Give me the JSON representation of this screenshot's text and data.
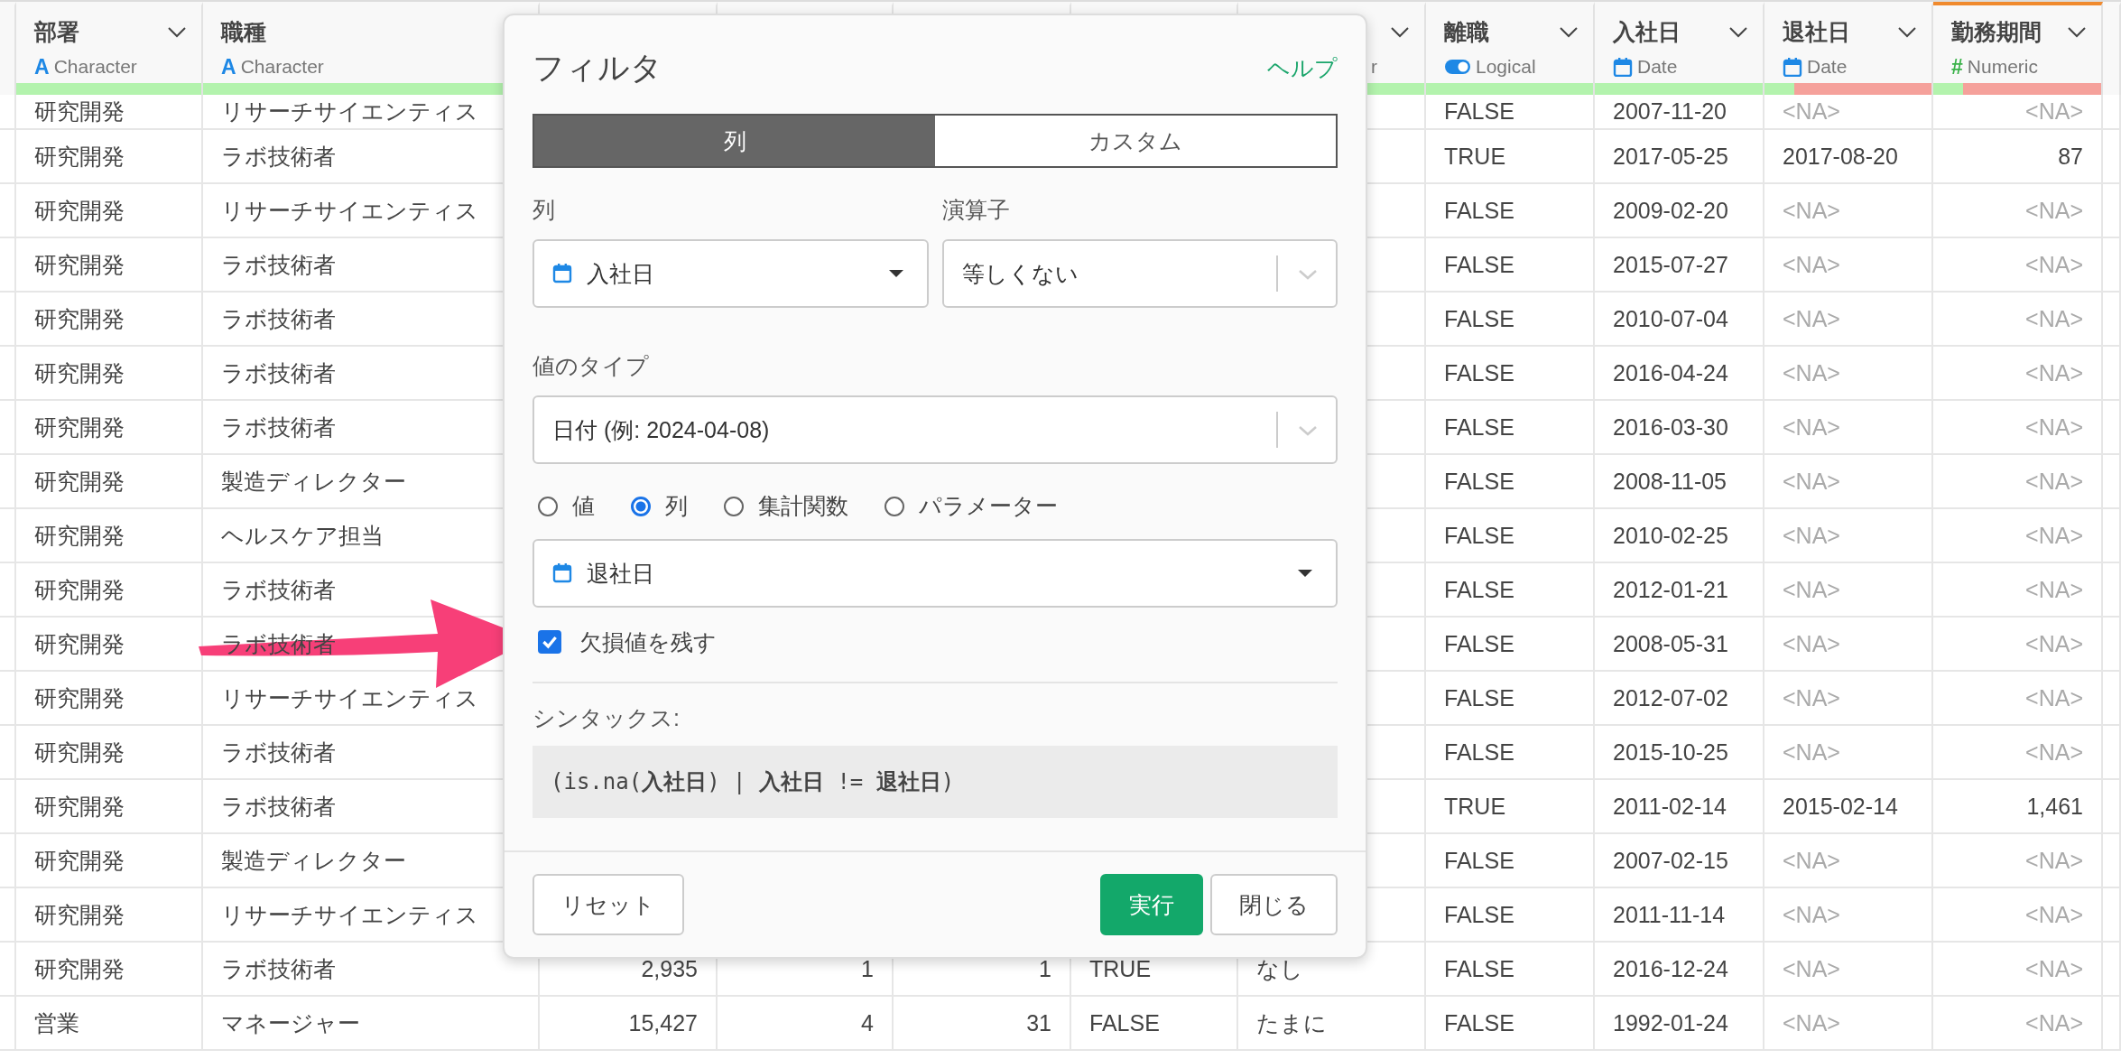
{
  "table": {
    "columns": [
      {
        "kind": "text",
        "name": "部署",
        "type_icon": "A",
        "type_label": "Character",
        "level": 1,
        "selected": false,
        "menu": true
      },
      {
        "kind": "text",
        "name": "職種",
        "type_icon": "A",
        "type_label": "Character",
        "level": 1,
        "selected": false
      },
      {
        "kind": "number"
      },
      {
        "kind": "number"
      },
      {
        "kind": "number"
      },
      {
        "kind": "logical"
      },
      {
        "kind": "text",
        "type_label": "r",
        "clipped": true,
        "level": 1,
        "menu": true
      },
      {
        "kind": "logical",
        "name": "離職",
        "type_label": "Logical",
        "level": 1,
        "selected": false,
        "menu": true
      },
      {
        "kind": "date",
        "name": "入社日",
        "type_label": "Date",
        "level": 1,
        "selected": false,
        "menu": true
      },
      {
        "kind": "date",
        "name": "退社日",
        "type_label": "Date",
        "level": 0.18,
        "selected": false,
        "menu": true
      },
      {
        "kind": "number",
        "name": "勤務期間",
        "type_icon": "#",
        "type_label": "Numeric",
        "level": 0.18,
        "selected": true,
        "menu": true
      }
    ],
    "rows": [
      {
        "cells": [
          "研究開発",
          "リサーチサイエンティス",
          null,
          null,
          null,
          null,
          null,
          "FALSE",
          "2007-11-20",
          {
            "text": "<NA>",
            "missing": true
          },
          {
            "text": "<NA>",
            "missing": true
          }
        ]
      },
      {
        "cells": [
          "研究開発",
          "ラボ技術者",
          null,
          null,
          null,
          null,
          null,
          "TRUE",
          "2017-05-25",
          "2017-08-20",
          "87"
        ]
      },
      {
        "cells": [
          "研究開発",
          "リサーチサイエンティス",
          null,
          null,
          null,
          null,
          null,
          "FALSE",
          "2009-02-20",
          {
            "text": "<NA>",
            "missing": true
          },
          {
            "text": "<NA>",
            "missing": true
          }
        ]
      },
      {
        "cells": [
          "研究開発",
          "ラボ技術者",
          null,
          null,
          null,
          null,
          null,
          "FALSE",
          "2015-07-27",
          {
            "text": "<NA>",
            "missing": true
          },
          {
            "text": "<NA>",
            "missing": true
          }
        ]
      },
      {
        "cells": [
          "研究開発",
          "ラボ技術者",
          null,
          null,
          null,
          null,
          null,
          "FALSE",
          "2010-07-04",
          {
            "text": "<NA>",
            "missing": true
          },
          {
            "text": "<NA>",
            "missing": true
          }
        ]
      },
      {
        "cells": [
          "研究開発",
          "ラボ技術者",
          null,
          null,
          null,
          null,
          null,
          "FALSE",
          "2016-04-24",
          {
            "text": "<NA>",
            "missing": true
          },
          {
            "text": "<NA>",
            "missing": true
          }
        ]
      },
      {
        "cells": [
          "研究開発",
          "ラボ技術者",
          null,
          null,
          null,
          null,
          null,
          "FALSE",
          "2016-03-30",
          {
            "text": "<NA>",
            "missing": true
          },
          {
            "text": "<NA>",
            "missing": true
          }
        ]
      },
      {
        "cells": [
          "研究開発",
          "製造ディレクター",
          null,
          null,
          null,
          null,
          null,
          "FALSE",
          "2008-11-05",
          {
            "text": "<NA>",
            "missing": true
          },
          {
            "text": "<NA>",
            "missing": true
          }
        ]
      },
      {
        "cells": [
          "研究開発",
          "ヘルスケア担当",
          null,
          null,
          null,
          null,
          null,
          "FALSE",
          "2010-02-25",
          {
            "text": "<NA>",
            "missing": true
          },
          {
            "text": "<NA>",
            "missing": true
          }
        ]
      },
      {
        "cells": [
          "研究開発",
          "ラボ技術者",
          null,
          null,
          null,
          null,
          null,
          "FALSE",
          "2012-01-21",
          {
            "text": "<NA>",
            "missing": true
          },
          {
            "text": "<NA>",
            "missing": true
          }
        ]
      },
      {
        "cells": [
          "研究開発",
          "ラボ技術者",
          null,
          null,
          null,
          null,
          null,
          "FALSE",
          "2008-05-31",
          {
            "text": "<NA>",
            "missing": true
          },
          {
            "text": "<NA>",
            "missing": true
          }
        ]
      },
      {
        "cells": [
          "研究開発",
          "リサーチサイエンティス",
          null,
          null,
          null,
          null,
          null,
          "FALSE",
          "2012-07-02",
          {
            "text": "<NA>",
            "missing": true
          },
          {
            "text": "<NA>",
            "missing": true
          }
        ]
      },
      {
        "cells": [
          "研究開発",
          "ラボ技術者",
          null,
          null,
          null,
          null,
          null,
          "FALSE",
          "2015-10-25",
          {
            "text": "<NA>",
            "missing": true
          },
          {
            "text": "<NA>",
            "missing": true
          }
        ]
      },
      {
        "cells": [
          "研究開発",
          "ラボ技術者",
          null,
          null,
          null,
          null,
          null,
          "TRUE",
          "2011-02-14",
          "2015-02-14",
          "1,461"
        ]
      },
      {
        "cells": [
          "研究開発",
          "製造ディレクター",
          null,
          null,
          null,
          null,
          null,
          "FALSE",
          "2007-02-15",
          {
            "text": "<NA>",
            "missing": true
          },
          {
            "text": "<NA>",
            "missing": true
          }
        ]
      },
      {
        "cells": [
          "研究開発",
          "リサーチサイエンティス",
          null,
          null,
          null,
          null,
          null,
          "FALSE",
          "2011-11-14",
          {
            "text": "<NA>",
            "missing": true
          },
          {
            "text": "<NA>",
            "missing": true
          }
        ]
      },
      {
        "cells": [
          "研究開発",
          "ラボ技術者",
          "2,935",
          "1",
          "1",
          "TRUE",
          "なし",
          "FALSE",
          "2016-12-24",
          {
            "text": "<NA>",
            "missing": true
          },
          {
            "text": "<NA>",
            "missing": true
          }
        ]
      },
      {
        "cells": [
          "営業",
          "マネージャー",
          "15,427",
          "4",
          "31",
          "FALSE",
          "たまに",
          "FALSE",
          "1992-01-24",
          {
            "text": "<NA>",
            "missing": true
          },
          {
            "text": "<NA>",
            "missing": true
          }
        ]
      }
    ]
  },
  "dialog": {
    "title": "フィルタ",
    "help": "ヘルプ",
    "tabs": [
      {
        "label": "列",
        "selected": true
      },
      {
        "label": "カスタム",
        "selected": false
      }
    ],
    "column_label": "列",
    "column_select": {
      "value": "入社日",
      "kind": "date"
    },
    "operator_label": "演算子",
    "operator_select": {
      "value": "等しくない"
    },
    "value_type_label": "値のタイプ",
    "value_type_select": {
      "value": "日付 (例: 2024-04-08)"
    },
    "value_sources": [
      {
        "label": "値",
        "selected": false
      },
      {
        "label": "列",
        "selected": true
      },
      {
        "label": "集計関数",
        "selected": false
      },
      {
        "label": "パラメーター",
        "selected": false
      }
    ],
    "value_column_select": {
      "value": "退社日",
      "kind": "date"
    },
    "keep_missing": {
      "label": "欠損値を残す",
      "checked": true
    },
    "syntax_label": "シンタックス:",
    "syntax": "(is.na(**入社日**) | **入社日** != **退社日**)",
    "buttons": [
      {
        "label": "リセット",
        "kind": "reset"
      },
      {
        "label": "実行",
        "kind": "primary"
      },
      {
        "label": "閉じる",
        "kind": "default"
      }
    ]
  }
}
